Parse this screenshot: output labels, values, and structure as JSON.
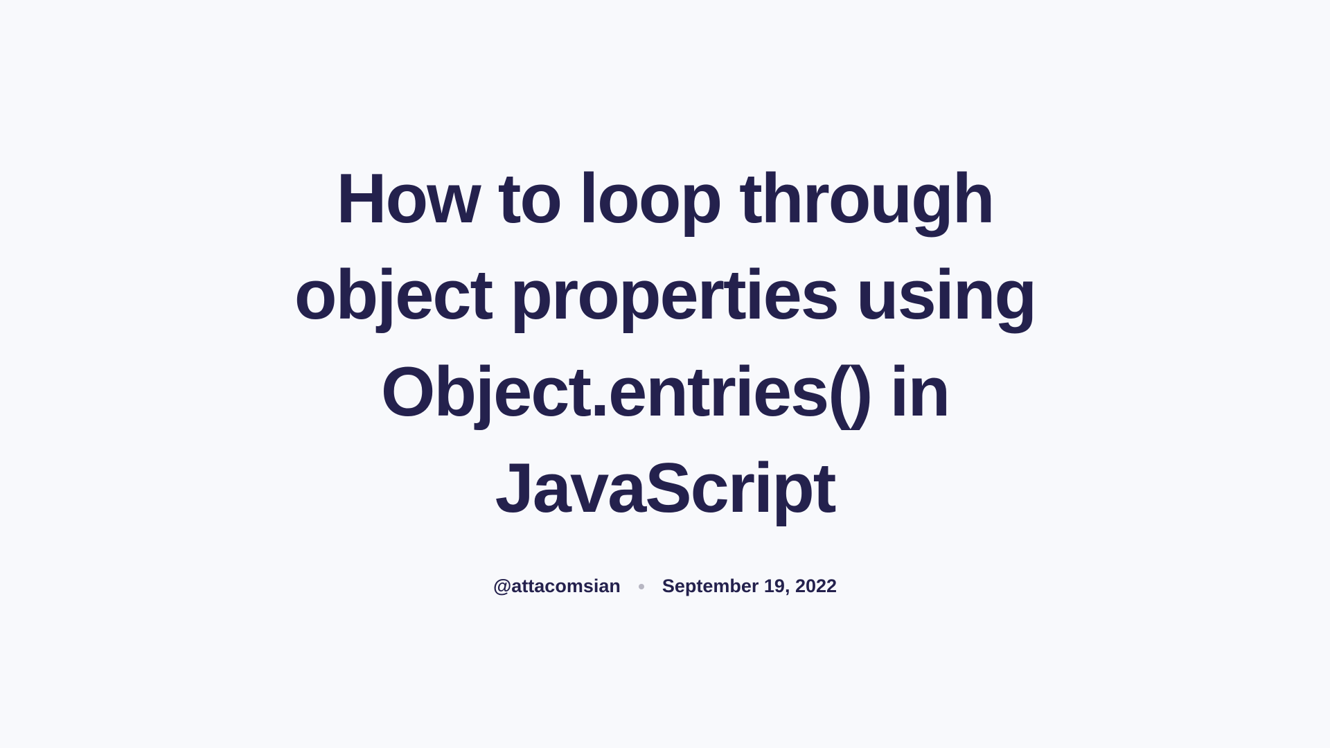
{
  "post": {
    "title": "How to loop through object properties using Object.entries() in JavaScript",
    "author_handle": "@attacomsian",
    "date": "September 19, 2022"
  }
}
